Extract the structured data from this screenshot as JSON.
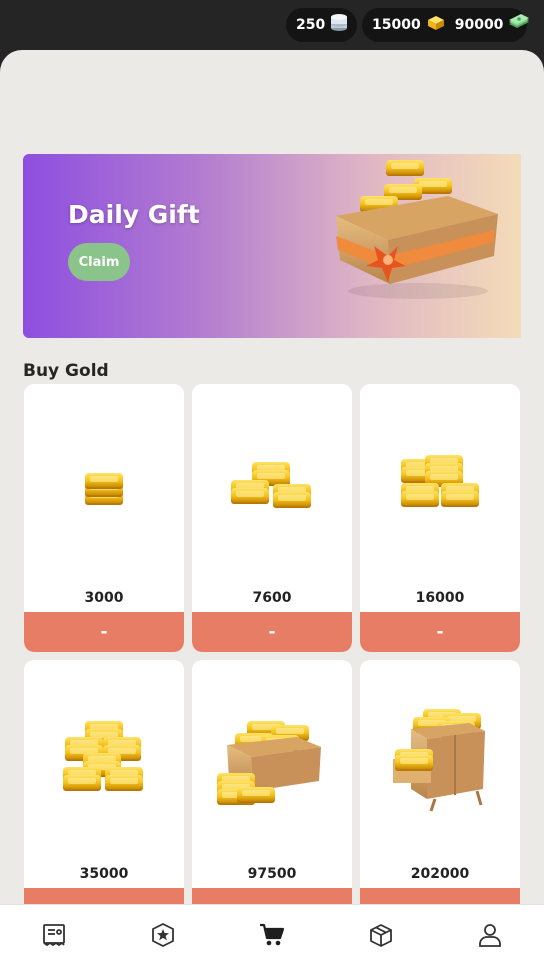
{
  "currencies": {
    "silver": "250",
    "gold": "15000",
    "cash": "90000"
  },
  "banner": {
    "title": "Daily Gift",
    "claim_label": "Claim"
  },
  "section_title": "Buy Gold",
  "products": [
    {
      "amount": "3000",
      "price": "-",
      "art": "gold-bar-1-icon"
    },
    {
      "amount": "7600",
      "price": "-",
      "art": "gold-bars-3-icon"
    },
    {
      "amount": "16000",
      "price": "-",
      "art": "gold-bars-5-icon"
    },
    {
      "amount": "35000",
      "price": "-",
      "art": "gold-bars-pile-icon"
    },
    {
      "amount": "97500",
      "price": "-",
      "art": "gold-box-icon"
    },
    {
      "amount": "202000",
      "price": "-",
      "art": "gold-cabinet-icon"
    }
  ],
  "nav": [
    {
      "icon": "receipt-icon"
    },
    {
      "icon": "star-badge-icon"
    },
    {
      "icon": "cart-icon",
      "active": true
    },
    {
      "icon": "package-icon"
    },
    {
      "icon": "profile-icon"
    }
  ],
  "colors": {
    "buy_button": "#e87d66",
    "claim_button": "#8bc48a",
    "banner_start": "#8e4ee0",
    "banner_end": "#f4dcb8"
  }
}
